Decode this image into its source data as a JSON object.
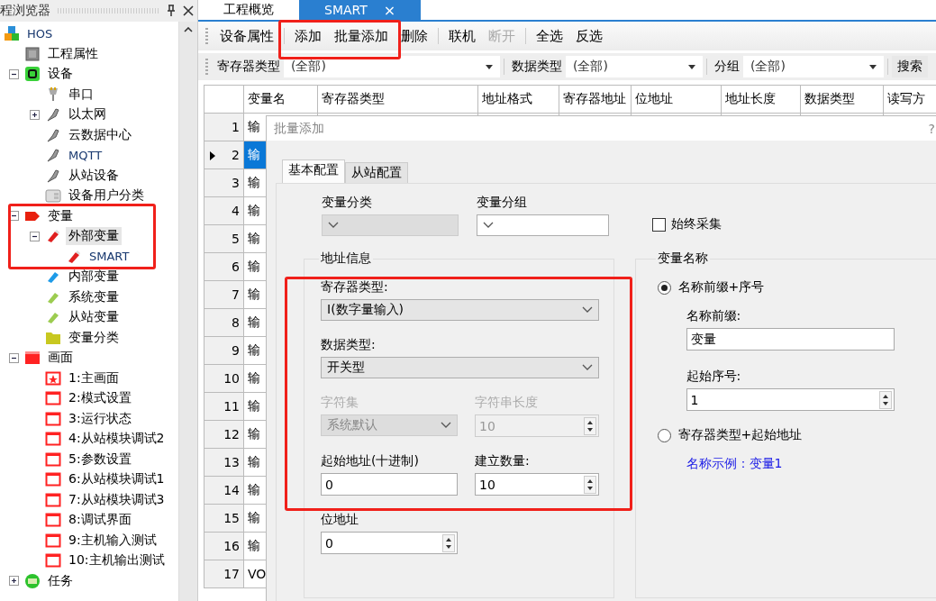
{
  "explorer": {
    "title": "程浏览器",
    "tree": [
      {
        "label": "HOS",
        "kind": "hos",
        "selected": false,
        "children": [
          {
            "label": "工程属性",
            "kind": "props",
            "selected": false
          },
          {
            "label": "设备",
            "kind": "device",
            "expanded": true,
            "selected": false,
            "children": [
              {
                "label": "串口",
                "kind": "serial",
                "selected": false
              },
              {
                "label": "以太网",
                "kind": "plug",
                "expanded": false,
                "selected": false
              },
              {
                "label": "云数据中心",
                "kind": "plug",
                "selected": false
              },
              {
                "label": "MQTT",
                "kind": "plug",
                "selected": false
              },
              {
                "label": "从站设备",
                "kind": "plug",
                "selected": false
              },
              {
                "label": "设备用户分类",
                "kind": "panel",
                "selected": false
              }
            ]
          },
          {
            "label": "变量",
            "kind": "tag-red",
            "expanded": true,
            "selected": false,
            "children": [
              {
                "label": "外部变量",
                "kind": "pen-red",
                "expanded": true,
                "selected": true,
                "children": [
                  {
                    "label": "SMART",
                    "kind": "pen-red",
                    "selected": false
                  }
                ]
              },
              {
                "label": "内部变量",
                "kind": "pen-blue",
                "selected": false
              },
              {
                "label": "系统变量",
                "kind": "pen-green",
                "selected": false
              },
              {
                "label": "从站变量",
                "kind": "pen-green",
                "selected": false
              },
              {
                "label": "变量分类",
                "kind": "folder",
                "selected": false
              }
            ]
          },
          {
            "label": "画面",
            "kind": "screen-big",
            "expanded": true,
            "selected": false,
            "children": [
              {
                "label": "1:主画面",
                "kind": "screen-star",
                "selected": false
              },
              {
                "label": "2:模式设置",
                "kind": "screen",
                "selected": false
              },
              {
                "label": "3:运行状态",
                "kind": "screen",
                "selected": false
              },
              {
                "label": "4:从站模块调试2",
                "kind": "screen",
                "selected": false
              },
              {
                "label": "5:参数设置",
                "kind": "screen",
                "selected": false
              },
              {
                "label": "6:从站模块调试1",
                "kind": "screen",
                "selected": false
              },
              {
                "label": "7:从站模块调试3",
                "kind": "screen",
                "selected": false
              },
              {
                "label": "8:调试界面",
                "kind": "screen",
                "selected": false
              },
              {
                "label": "9:主机输入测试",
                "kind": "screen",
                "selected": false
              },
              {
                "label": "10:主机输出测试",
                "kind": "screen",
                "selected": false
              }
            ]
          },
          {
            "label": "任务",
            "kind": "task",
            "expanded": false,
            "selected": false
          }
        ]
      }
    ]
  },
  "tabs": [
    {
      "label": "工程概览",
      "selected": false
    },
    {
      "label": "SMART",
      "selected": true,
      "close": "×"
    }
  ],
  "toolbar": [
    [
      {
        "label": "设备属性",
        "disabled": false
      }
    ],
    [
      {
        "label": "添加",
        "disabled": false
      },
      {
        "label": "批量添加",
        "disabled": false
      },
      {
        "label": "删除",
        "disabled": false
      }
    ],
    [
      {
        "label": "联机",
        "disabled": false
      },
      {
        "label": "断开",
        "disabled": true
      }
    ],
    [
      {
        "label": "全选",
        "disabled": false
      },
      {
        "label": "反选",
        "disabled": false
      }
    ]
  ],
  "filters": [
    {
      "label": "寄存器类型",
      "value": "(全部)"
    },
    {
      "label": "数据类型",
      "value": "(全部)"
    },
    {
      "label": "分组",
      "value": "(全部)"
    }
  ],
  "search_button": "搜索",
  "table": {
    "columns": [
      "变量名",
      "寄存器类型",
      "地址格式",
      "寄存器地址",
      "位地址",
      "地址长度",
      "数据类型",
      "读写方"
    ],
    "rows": [
      {
        "num": "1",
        "name": "输",
        "selected": false
      },
      {
        "num": "2",
        "name": "输",
        "selected": true
      },
      {
        "num": "3",
        "name": "输",
        "selected": false
      },
      {
        "num": "4",
        "name": "输",
        "selected": false
      },
      {
        "num": "5",
        "name": "输",
        "selected": false
      },
      {
        "num": "6",
        "name": "输",
        "selected": false
      },
      {
        "num": "7",
        "name": "输",
        "selected": false
      },
      {
        "num": "8",
        "name": "输",
        "selected": false
      },
      {
        "num": "9",
        "name": "输",
        "selected": false
      },
      {
        "num": "10",
        "name": "输",
        "selected": false
      },
      {
        "num": "11",
        "name": "输",
        "selected": false
      },
      {
        "num": "12",
        "name": "输",
        "selected": false
      },
      {
        "num": "13",
        "name": "输",
        "selected": false
      },
      {
        "num": "14",
        "name": "输",
        "selected": false
      },
      {
        "num": "15",
        "name": "输",
        "selected": false
      },
      {
        "num": "16",
        "name": "输",
        "selected": false
      },
      {
        "num": "17",
        "name": "VO",
        "selected": false
      }
    ]
  },
  "dialog": {
    "title": "批量添加",
    "help": "?",
    "tabs": [
      {
        "label": "基本配置",
        "selected": true
      },
      {
        "label": "从站配置",
        "selected": false
      }
    ],
    "category": {
      "label": "变量分类",
      "disabled": true
    },
    "group": {
      "label": "变量分组",
      "disabled": false
    },
    "always_collect": {
      "label": "始终采集",
      "checked": false
    },
    "address_info": {
      "title": "地址信息",
      "register_type": {
        "label": "寄存器类型:",
        "value": "I(数字量输入)"
      },
      "data_type": {
        "label": "数据类型:",
        "value": "开关型"
      },
      "charset": {
        "label": "字符集",
        "value": "系统默认",
        "disabled": true
      },
      "string_length": {
        "label": "字符串长度",
        "value": "10",
        "disabled": true
      },
      "start_address": {
        "label": "起始地址(十进制)",
        "value": "0"
      },
      "count": {
        "label": "建立数量:",
        "value": "10"
      },
      "bit_address": {
        "label": "位地址",
        "value": "0"
      }
    },
    "variable_name": {
      "title": "变量名称",
      "options": [
        {
          "label": "名称前缀+序号",
          "selected": true
        },
        {
          "label": "寄存器类型+起始地址",
          "selected": false
        }
      ],
      "prefix": {
        "label": "名称前缀:",
        "value": "变量"
      },
      "start_index": {
        "label": "起始序号:",
        "value": "1"
      },
      "example": "名称示例：变量1"
    }
  }
}
